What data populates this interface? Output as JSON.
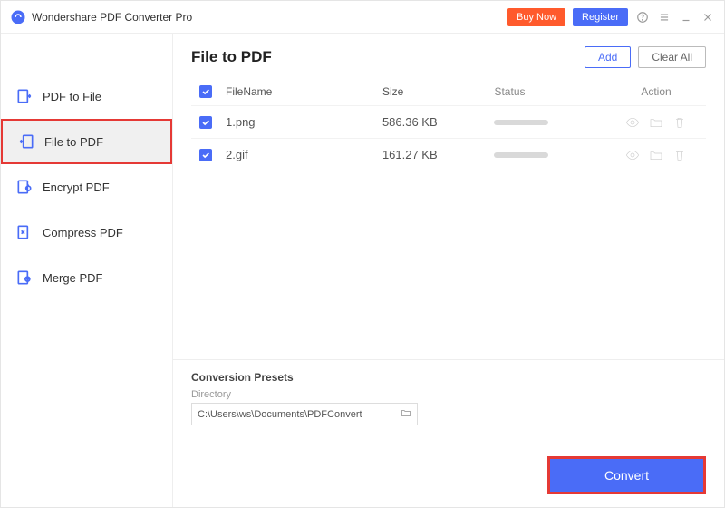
{
  "titlebar": {
    "app_name": "Wondershare PDF Converter Pro",
    "buy_now": "Buy Now",
    "register": "Register"
  },
  "sidebar": {
    "items": [
      {
        "label": "PDF to File"
      },
      {
        "label": "File to PDF"
      },
      {
        "label": "Encrypt PDF"
      },
      {
        "label": "Compress PDF"
      },
      {
        "label": "Merge PDF"
      }
    ],
    "active_index": 1
  },
  "main": {
    "title": "File to PDF",
    "add_label": "Add",
    "clear_label": "Clear All",
    "columns": {
      "name": "FileName",
      "size": "Size",
      "status": "Status",
      "action": "Action"
    },
    "rows": [
      {
        "name": "1.png",
        "size": "586.36 KB"
      },
      {
        "name": "2.gif",
        "size": "161.27 KB"
      }
    ]
  },
  "footer": {
    "presets": "Conversion Presets",
    "directory_label": "Directory",
    "directory_value": "C:\\Users\\ws\\Documents\\PDFConvert",
    "convert": "Convert"
  }
}
